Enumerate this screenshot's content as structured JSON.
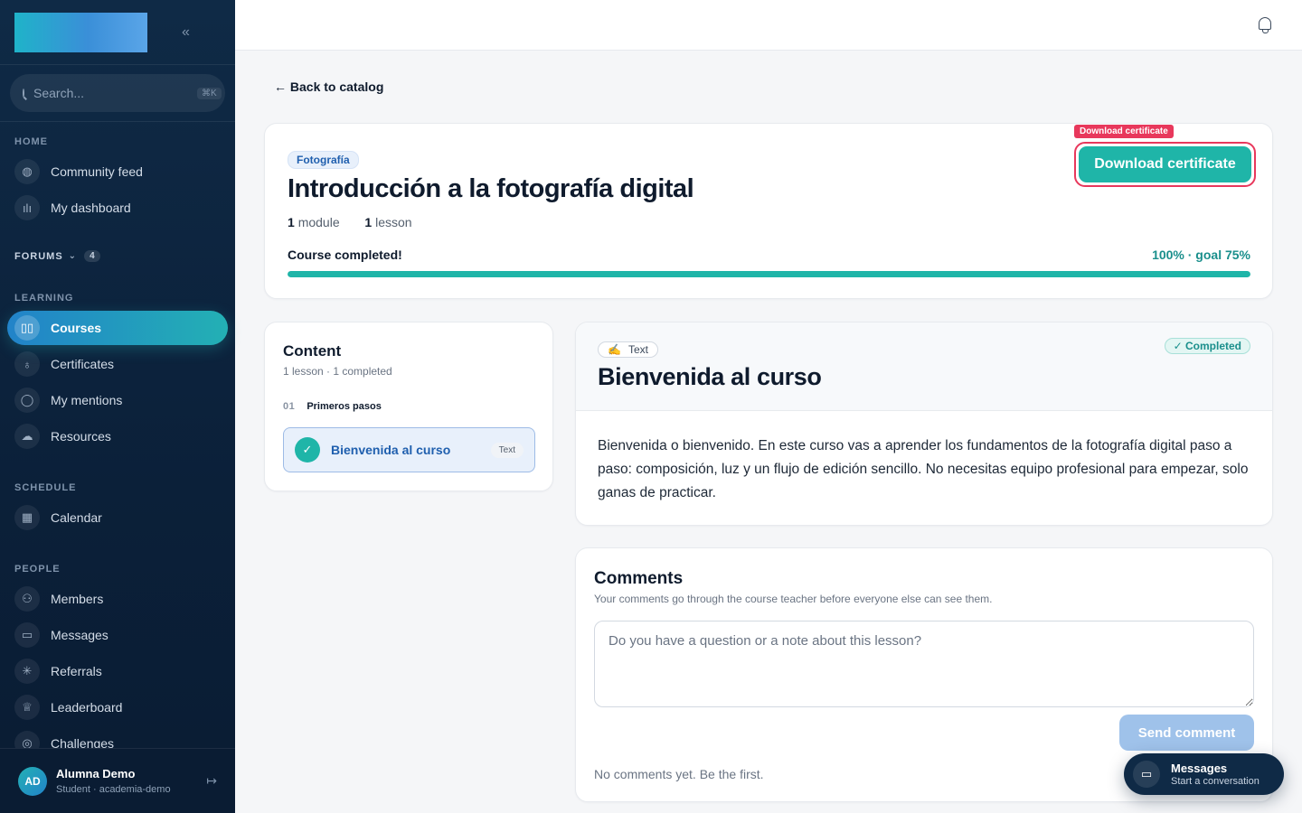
{
  "sidebar": {
    "search_placeholder": "Search...",
    "search_shortcut": "⌘K",
    "sections": {
      "home": "HOME",
      "forums": "FORUMS",
      "forums_count": "4",
      "learning": "LEARNING",
      "schedule": "SCHEDULE",
      "people": "PEOPLE"
    },
    "items": {
      "community_feed": "Community feed",
      "my_dashboard": "My dashboard",
      "courses": "Courses",
      "certificates": "Certificates",
      "my_mentions": "My mentions",
      "resources": "Resources",
      "calendar": "Calendar",
      "members": "Members",
      "messages": "Messages",
      "referrals": "Referrals",
      "leaderboard": "Leaderboard",
      "challenges": "Challenges"
    },
    "user": {
      "initials": "AD",
      "name": "Alumna Demo",
      "role": "Student · academia-demo"
    }
  },
  "back_link": "← Back to catalog",
  "course": {
    "category": "Fotografía",
    "title": "Introducción a la fotografía digital",
    "modules_count": "1",
    "modules_label": "module",
    "lessons_count": "1",
    "lessons_label": "lesson",
    "status": "Course completed!",
    "progress_text": "100% · goal 75%",
    "progress_fraction": 1.0,
    "certificate_tag": "Download certificate",
    "certificate_button": "Download certificate"
  },
  "content_panel": {
    "title": "Content",
    "summary": "1 lesson · 1 completed",
    "module_number": "01",
    "module_name": "Primeros pasos",
    "lesson_name": "Bienvenida al curso",
    "lesson_type": "Text"
  },
  "lesson": {
    "type_emoji": "✍️",
    "type_label": "Text",
    "completed_label": "✓ Completed",
    "title": "Bienvenida al curso",
    "body": "Bienvenida o bienvenido. En este curso vas a aprender los fundamentos de la fotografía digital paso a paso: composición, luz y un flujo de edición sencillo. No necesitas equipo profesional para empezar, solo ganas de practicar."
  },
  "comments": {
    "title": "Comments",
    "subtitle": "Your comments go through the course teacher before everyone else can see them.",
    "placeholder": "Do you have a question or a note about this lesson?",
    "send_label": "Send comment",
    "empty_text": "No comments yet. Be the first."
  },
  "messages_float": {
    "title": "Messages",
    "subtitle": "Start a conversation"
  },
  "colors": {
    "accent_teal": "#1fb5a8",
    "brand_blue": "#1f5fae",
    "highlight_red": "#e8385c",
    "sidebar_bg": "#0f2a46"
  }
}
